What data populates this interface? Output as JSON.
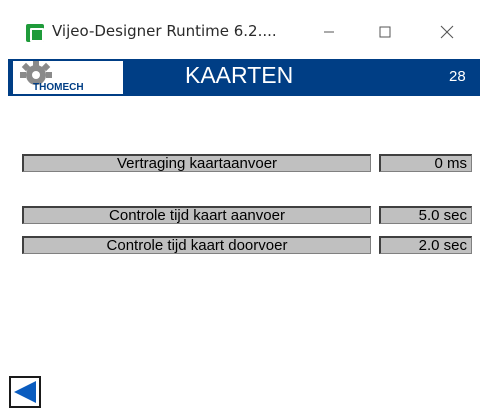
{
  "window": {
    "title": "Vijeo-Designer Runtime 6.2....",
    "app_icon": "vijeo-app-icon",
    "controls": [
      "minimize-icon",
      "maximize-icon",
      "close-icon"
    ]
  },
  "header": {
    "logo_text": "THOMECH",
    "title": "KAARTEN",
    "page_number": "28",
    "background_color": "#003e85"
  },
  "settings": [
    {
      "label": "Vertraging kaartaanvoer",
      "value": "0 ms"
    },
    {
      "label": "Controle tijd kaart aanvoer",
      "value": "5.0 sec"
    },
    {
      "label": "Controle tijd kaart doorvoer",
      "value": "2.0 sec"
    }
  ],
  "navigation": {
    "back_icon": "back-arrow-icon",
    "back_color": "#0a5cbf"
  }
}
